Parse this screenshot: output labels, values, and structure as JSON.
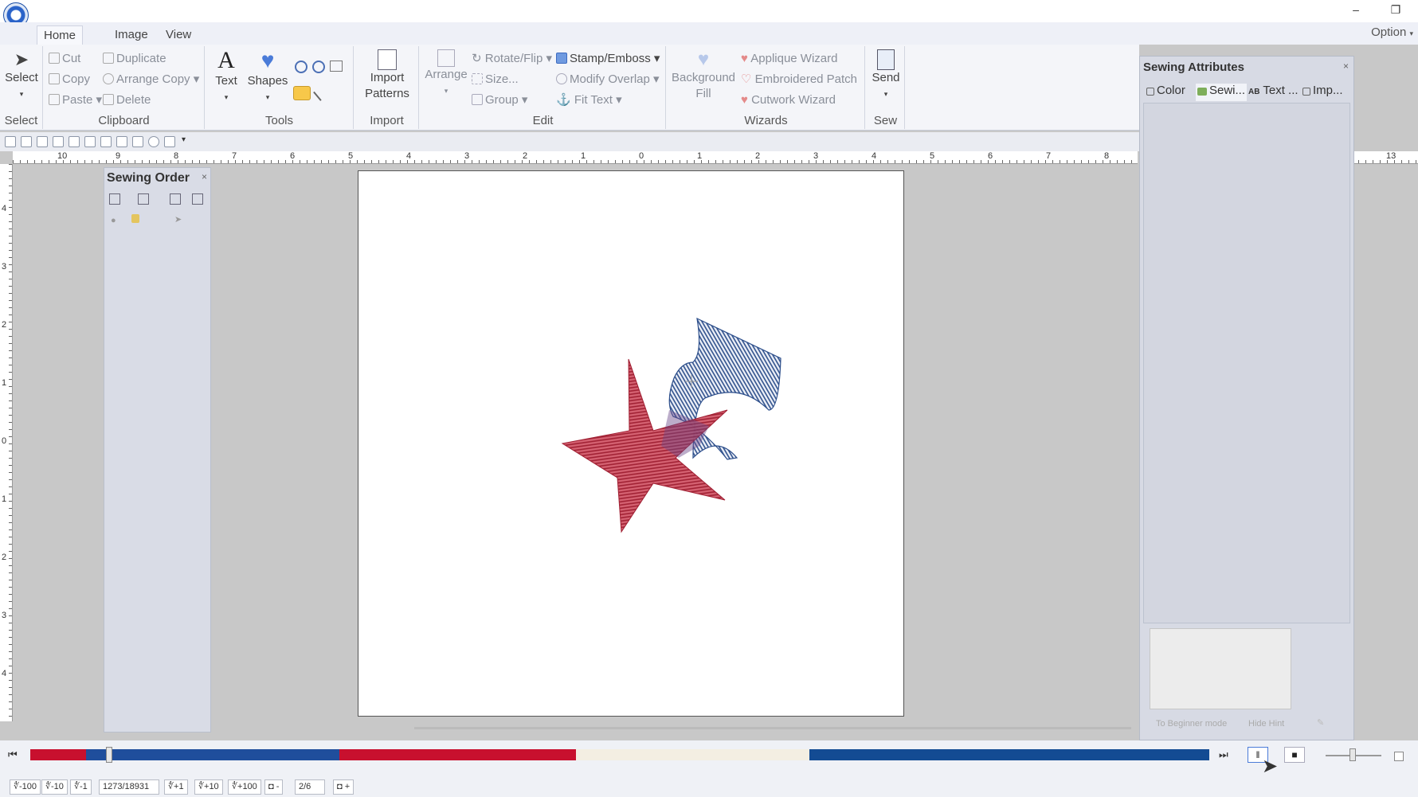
{
  "menu": {
    "tabs": [
      "Home",
      "Image",
      "View"
    ],
    "option": "Option"
  },
  "ribbon": {
    "select": {
      "label": "Select",
      "group": "Select"
    },
    "clipboard": {
      "cut": "Cut",
      "duplicate": "Duplicate",
      "copy": "Copy",
      "arrange_copy": "Arrange Copy",
      "paste": "Paste",
      "delete": "Delete",
      "group": "Clipboard"
    },
    "tools": {
      "text": "Text",
      "shapes": "Shapes",
      "group": "Tools"
    },
    "import": {
      "label1": "Import",
      "label2": "Patterns",
      "group": "Import"
    },
    "edit": {
      "arrange": "Arrange",
      "rotate_flip": "Rotate/Flip",
      "stamp_emboss": "Stamp/Emboss",
      "size": "Size...",
      "modify_overlap": "Modify Overlap",
      "group_btn": "Group",
      "fit_text": "Fit Text",
      "group": "Edit"
    },
    "wizards": {
      "background1": "Background",
      "background2": "Fill",
      "applique": "Applique Wizard",
      "patch": "Embroidered Patch",
      "cutwork": "Cutwork Wizard",
      "group": "Wizards"
    },
    "sew": {
      "send": "Send",
      "group": "Sew"
    }
  },
  "hruler_labels": [
    "10",
    "9",
    "8",
    "7",
    "6",
    "5",
    "4",
    "3",
    "2",
    "1",
    "0",
    "1",
    "2",
    "3",
    "4",
    "5",
    "6",
    "7",
    "8"
  ],
  "hruler_right_label": "13",
  "vruler_labels": [
    "4",
    "3",
    "2",
    "1",
    "0",
    "1",
    "2",
    "3",
    "4"
  ],
  "sewing_order": {
    "title": "Sewing Order"
  },
  "sewing_attributes": {
    "title": "Sewing Attributes",
    "tabs": [
      "Color",
      "Sewi...",
      "Text ...",
      "Imp..."
    ],
    "hint_buttons": [
      "To Beginner mode",
      "Hide Hint"
    ]
  },
  "playback": {
    "segments": [
      {
        "color": "#c8102e",
        "frac": 0.047
      },
      {
        "color": "#1f4e9c",
        "frac": 0.215
      },
      {
        "color": "#c8102e",
        "frac": 0.201
      },
      {
        "color": "#f3eee2",
        "frac": 0.198
      },
      {
        "color": "#134b93",
        "frac": 0.339
      }
    ],
    "position_fraction": 0.067
  },
  "status": {
    "back100": "-100",
    "back10": "-10",
    "back1": "-1",
    "stitch_current": "1273",
    "stitch_total": "/18931",
    "fwd1": "+1",
    "fwd10": "+10",
    "fwd100": "+100",
    "color_current": "2",
    "color_total": "/6"
  },
  "colors": {
    "ribbon_bg": "#f4f5f9",
    "panel_bg": "#d7dae4",
    "star_red": "#b01c30",
    "flag_blue": "#2b4d8a"
  }
}
